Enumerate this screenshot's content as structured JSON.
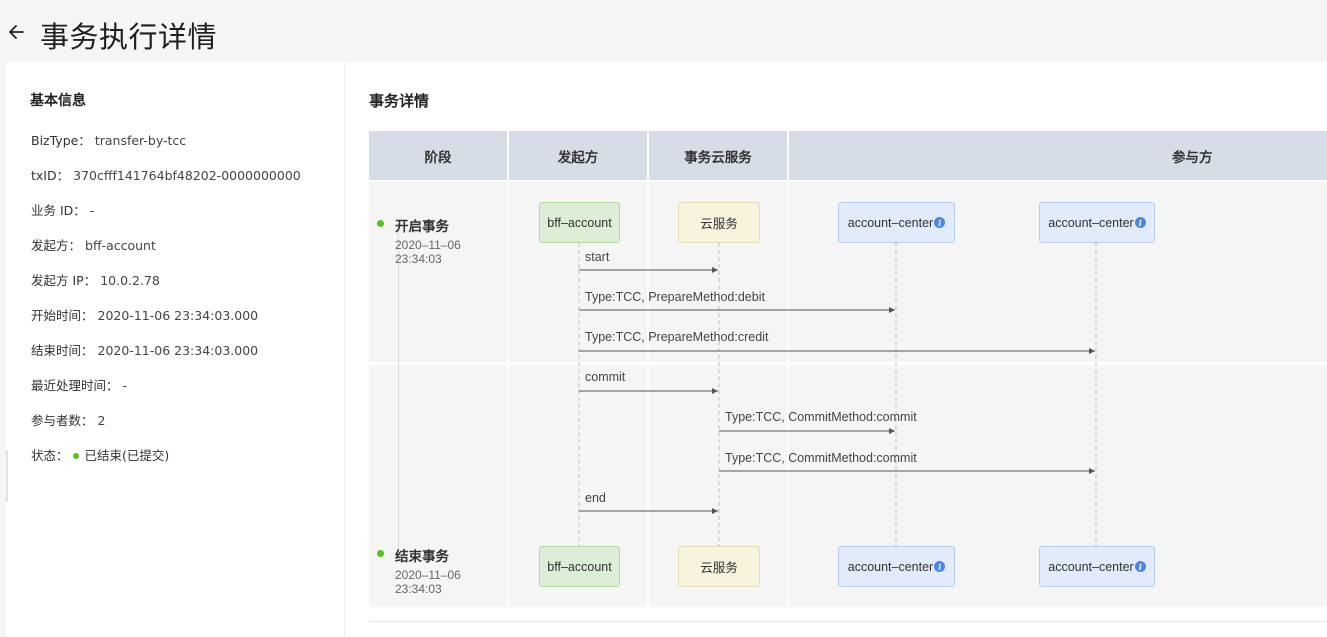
{
  "page": {
    "title": "事务执行详情"
  },
  "basic": {
    "title": "基本信息",
    "rows": [
      {
        "label": "BizType：",
        "value": "transfer-by-tcc"
      },
      {
        "label": "txID：",
        "value": "370cfff141764bf48202-0000000000"
      },
      {
        "label": "业务 ID：",
        "value": "-"
      },
      {
        "label": "发起方：",
        "value": "bff-account"
      },
      {
        "label": "发起方 IP：",
        "value": "10.0.2.78"
      },
      {
        "label": "开始时间：",
        "value": "2020-11-06 23:34:03.000"
      },
      {
        "label": "结束时间：",
        "value": "2020-11-06 23:34:03.000"
      },
      {
        "label": "最近处理时间：",
        "value": "-"
      },
      {
        "label": "参与者数：",
        "value": "2"
      }
    ],
    "status": {
      "label": "状态：",
      "value": "已结束(已提交)",
      "color": "#52c41a"
    }
  },
  "detail": {
    "title": "事务详情",
    "headers": {
      "phase": "阶段",
      "initiator": "发起方",
      "cloud": "事务云服务",
      "participants": "参与方"
    },
    "phases": [
      {
        "name": "开启事务",
        "time_date": "2020–11–06",
        "time_clock": "23:34:03"
      },
      {
        "name": "结束事务",
        "time_date": "2020–11–06",
        "time_clock": "23:34:03"
      }
    ],
    "lanes": {
      "initiator": "bff–account",
      "cloud": "云服务",
      "participant1": "account–center",
      "participant2": "account–center"
    },
    "messages": [
      {
        "label": "start"
      },
      {
        "label": "Type:TCC, PrepareMethod:debit"
      },
      {
        "label": "Type:TCC, PrepareMethod:credit"
      },
      {
        "label": "commit"
      },
      {
        "label": "Type:TCC, CommitMethod:commit"
      },
      {
        "label": "Type:TCC, CommitMethod:commit"
      },
      {
        "label": "end"
      }
    ]
  },
  "colors": {
    "success": "#52c41a",
    "header_bg": "#d7dde6",
    "info_blue": "#4a86e8"
  }
}
